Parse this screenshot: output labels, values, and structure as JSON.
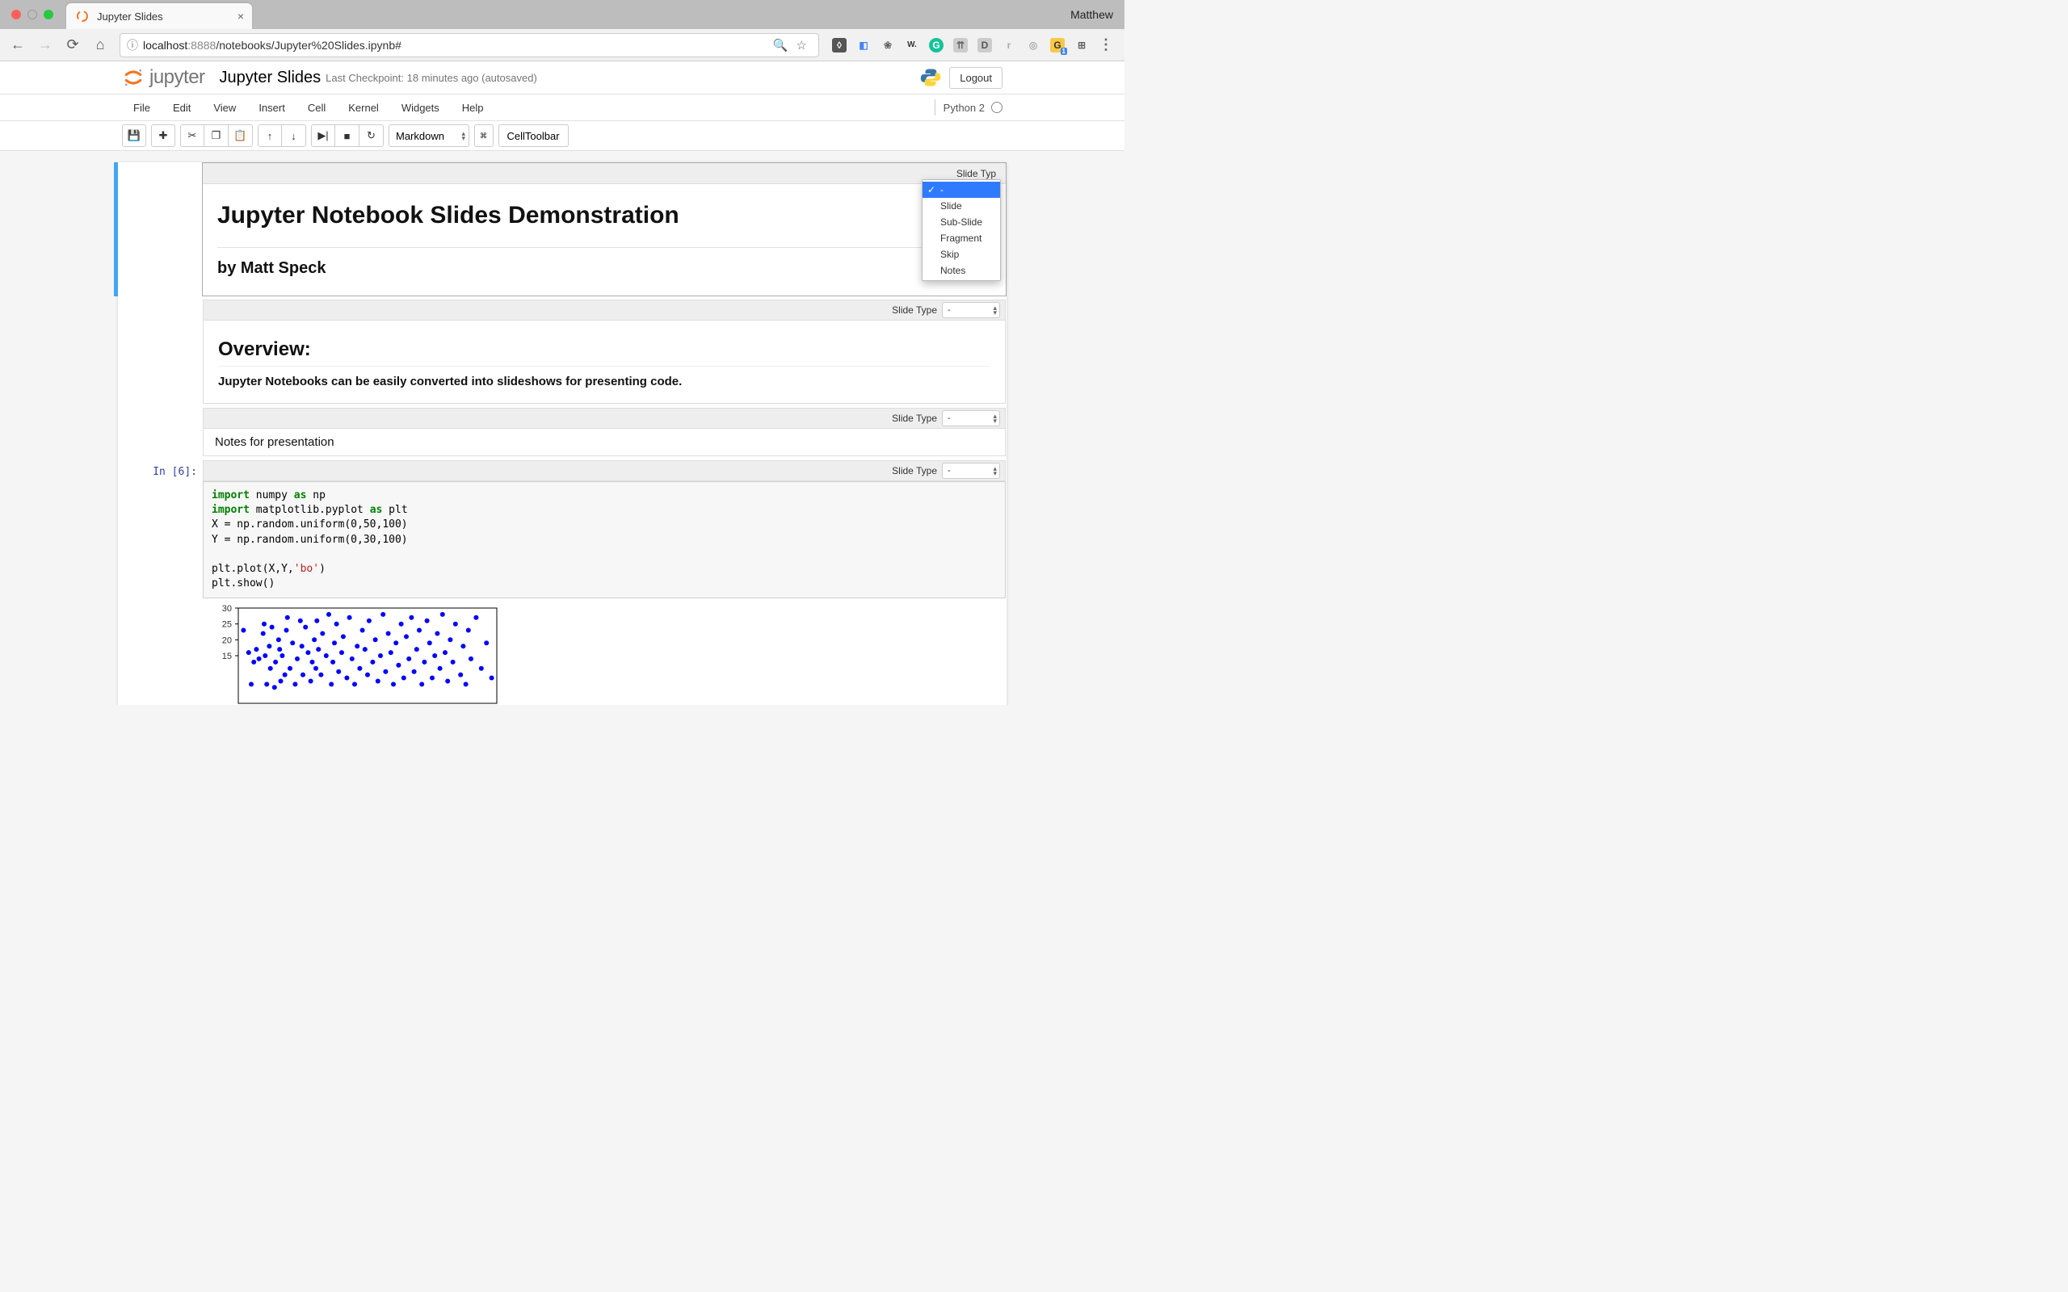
{
  "os": {
    "profile_name": "Matthew"
  },
  "browser": {
    "tab_title": "Jupyter Slides",
    "url_host": "localhost",
    "url_port": ":8888",
    "url_path": "/notebooks/Jupyter%20Slides.ipynb#"
  },
  "header": {
    "logo_text": "jupyter",
    "notebook_name": "Jupyter Slides",
    "checkpoint": "Last Checkpoint: 18 minutes ago (autosaved)",
    "logout": "Logout"
  },
  "menu": {
    "items": [
      "File",
      "Edit",
      "View",
      "Insert",
      "Cell",
      "Kernel",
      "Widgets",
      "Help"
    ],
    "kernel": "Python 2"
  },
  "toolbar": {
    "cell_type": "Markdown",
    "command_palette": "⌘",
    "celltoolbar": "CellToolbar"
  },
  "slide_type": {
    "label": "Slide Type",
    "label_truncated": "Slide Typ",
    "options": [
      "-",
      "Slide",
      "Sub-Slide",
      "Fragment",
      "Skip",
      "Notes"
    ]
  },
  "cells": {
    "c0": {
      "h1": "Jupyter Notebook Slides Demonstration",
      "h3": "by Matt Speck"
    },
    "c1": {
      "h2": "Overview:",
      "p": "Jupyter Notebooks can be easily converted into slideshows for presenting code."
    },
    "c2": {
      "text": "Notes for presentation"
    },
    "c3": {
      "prompt": "In [6]:",
      "code_lines": {
        "import1_kw": "import",
        "import1_mod": " numpy ",
        "import1_as": "as",
        "import1_alias": " np",
        "import2_kw": "import",
        "import2_mod": " matplotlib.pyplot ",
        "import2_as": "as",
        "import2_alias": " plt",
        "l3": "X = np.random.uniform(0,50,100)",
        "l4": "Y = np.random.uniform(0,30,100)",
        "l5a": "plt.plot(X,Y,",
        "l5b": "'bo'",
        "l5c": ")",
        "l6": "plt.show()"
      }
    }
  },
  "chart_data": {
    "type": "scatter",
    "title": "",
    "xlabel": "",
    "ylabel": "",
    "xlim": [
      0,
      50
    ],
    "ylim": [
      0,
      30
    ],
    "yticks_visible": [
      15,
      20,
      25,
      30
    ],
    "series": [
      {
        "name": "bo",
        "color": "#0000ff",
        "x": [
          1,
          2,
          2.5,
          3,
          3.5,
          4,
          4.8,
          5,
          5.2,
          5.5,
          6,
          6.2,
          6.5,
          7,
          7.2,
          7.8,
          8,
          8.2,
          8.5,
          9,
          9.3,
          9.5,
          10,
          10.5,
          11,
          11.4,
          12,
          12.3,
          12.5,
          13,
          13.5,
          14,
          14.3,
          14.7,
          15,
          15.2,
          15.5,
          16,
          16.3,
          17,
          17.5,
          18,
          18.3,
          18.6,
          19,
          19.4,
          20,
          20.3,
          21,
          21.5,
          22,
          22.5,
          23,
          23.5,
          24,
          24.5,
          25,
          25.3,
          26,
          26.5,
          27,
          27.5,
          28,
          28.5,
          29,
          29.5,
          30,
          30.5,
          31,
          31.5,
          32,
          32.5,
          33,
          33.5,
          34,
          34.5,
          35,
          35.5,
          36,
          36.5,
          37,
          37.5,
          38,
          38.5,
          39,
          39.5,
          40,
          40.5,
          41,
          41.5,
          42,
          43,
          43.5,
          44,
          44.5,
          45,
          46,
          47,
          48,
          49
        ],
        "y": [
          23,
          16,
          6,
          13,
          17,
          14,
          22,
          25,
          15,
          6,
          18,
          11,
          24,
          5,
          13,
          20,
          17,
          7,
          15,
          9,
          23,
          27,
          11,
          19,
          6,
          14,
          26,
          18,
          9,
          24,
          16,
          7,
          13,
          20,
          11,
          26,
          17,
          9,
          22,
          15,
          28,
          6,
          13,
          19,
          25,
          10,
          16,
          21,
          8,
          27,
          14,
          6,
          18,
          11,
          23,
          17,
          9,
          26,
          13,
          20,
          7,
          15,
          28,
          10,
          22,
          16,
          6,
          19,
          12,
          25,
          8,
          21,
          14,
          27,
          10,
          17,
          23,
          6,
          13,
          26,
          19,
          8,
          15,
          22,
          11,
          28,
          16,
          7,
          20,
          13,
          25,
          9,
          18,
          6,
          23,
          14,
          27,
          11,
          19,
          8
        ]
      }
    ]
  }
}
